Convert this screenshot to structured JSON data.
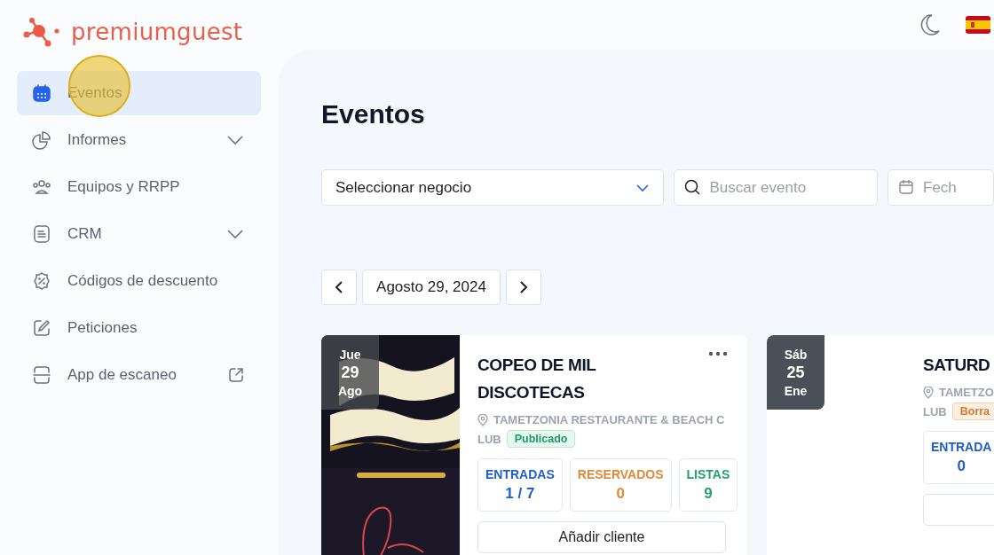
{
  "logo": {
    "text": "premiumguest"
  },
  "sidebar": {
    "items": [
      {
        "label": "Eventos",
        "selected": true,
        "expandable": false,
        "external": false,
        "highlighted": true
      },
      {
        "label": "Informes",
        "selected": false,
        "expandable": true,
        "external": false,
        "highlighted": false
      },
      {
        "label": "Equipos y RRPP",
        "selected": false,
        "expandable": false,
        "external": false,
        "highlighted": false
      },
      {
        "label": "CRM",
        "selected": false,
        "expandable": true,
        "external": false,
        "highlighted": false
      },
      {
        "label": "Códigos de descuento",
        "selected": false,
        "expandable": false,
        "external": false,
        "highlighted": false
      },
      {
        "label": "Peticiones",
        "selected": false,
        "expandable": false,
        "external": false,
        "highlighted": false
      },
      {
        "label": "App de escaneo",
        "selected": false,
        "expandable": false,
        "external": true,
        "highlighted": false
      }
    ]
  },
  "page_title": "Eventos",
  "filters": {
    "business_select": "Seleccionar negocio",
    "search": {
      "placeholder": "Buscar evento"
    },
    "date": {
      "placeholder": "Fech"
    }
  },
  "date_nav": {
    "date": "Agosto 29, 2024"
  },
  "events": [
    {
      "weekday": "Jue",
      "day": "29",
      "month": "Ago",
      "poster": true,
      "title": "COPEO DE MIL DISCOTECAS",
      "location_lines": [
        "TAMETZONIA RESTAURANTE & BEACH C",
        "LUB"
      ],
      "status": {
        "label": "Publicado",
        "kind": "published"
      },
      "menu": true,
      "stats": [
        {
          "label": "ENTRADAS",
          "value": "1 / 7",
          "kind": "tickets"
        },
        {
          "label": "RESERVADOS",
          "value": "0",
          "kind": "reserved"
        },
        {
          "label": "LISTAS",
          "value": "9",
          "kind": "lists"
        }
      ],
      "action": "Añadir cliente"
    },
    {
      "weekday": "Sáb",
      "day": "25",
      "month": "Ene",
      "poster": false,
      "title": "SATURD",
      "location_lines": [
        "TAMETZO",
        "LUB"
      ],
      "status": {
        "label": "Borra",
        "kind": "draft"
      },
      "menu": false,
      "stats": [
        {
          "label": "ENTRADA",
          "value": "0",
          "kind": "tickets"
        }
      ]
    }
  ]
}
